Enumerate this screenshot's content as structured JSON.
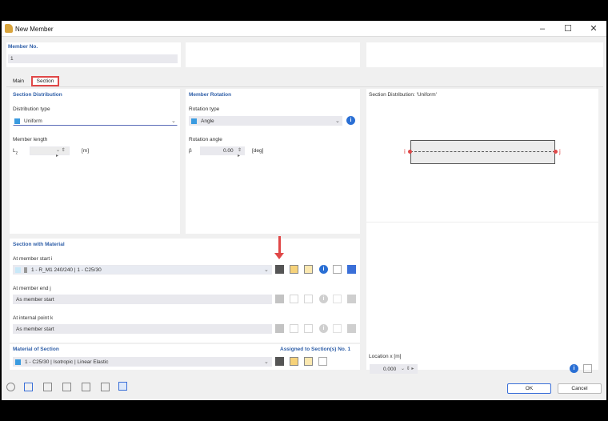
{
  "window": {
    "title": "New Member"
  },
  "header": {
    "member_no_label": "Member No.",
    "member_no_value": "1"
  },
  "tabs": [
    {
      "label": "Main"
    },
    {
      "label": "Section"
    }
  ],
  "section_distribution": {
    "title": "Section Distribution",
    "type_label": "Distribution type",
    "type_value": "Uniform",
    "length_label": "Member length",
    "length_symbol": "L",
    "length_symbol_sub": "z",
    "length_unit": "[m]"
  },
  "member_rotation": {
    "title": "Member Rotation",
    "type_label": "Rotation type",
    "type_value": "Angle",
    "angle_label": "Rotation angle",
    "angle_symbol": "β",
    "angle_value": "0.00",
    "angle_unit": "[deg]"
  },
  "section_with_material": {
    "title": "Section with Material",
    "start_label": "At member start i",
    "start_value": "1 - R_M1 240/240 | 1 - C25/30",
    "end_label": "At member end j",
    "end_value": "As member start",
    "internal_label": "At internal point k",
    "internal_value": "As member start"
  },
  "material": {
    "title": "Material of Section",
    "assigned": "Assigned to Section(s) No. 1",
    "value": "1 - C25/30 | Isotropic | Linear Elastic"
  },
  "preview": {
    "title": "Section Distribution: 'Uniform'",
    "node_i": "i",
    "node_j": "j",
    "location_label": "Location x [m]",
    "location_value": "0.000"
  },
  "footer": {
    "ok": "OK",
    "cancel": "Cancel"
  },
  "colors": {
    "accent": "#2f5fa8",
    "highlight": "#e04848",
    "uniform_swatch": "#3a9be0",
    "angle_swatch": "#3a9be0"
  }
}
